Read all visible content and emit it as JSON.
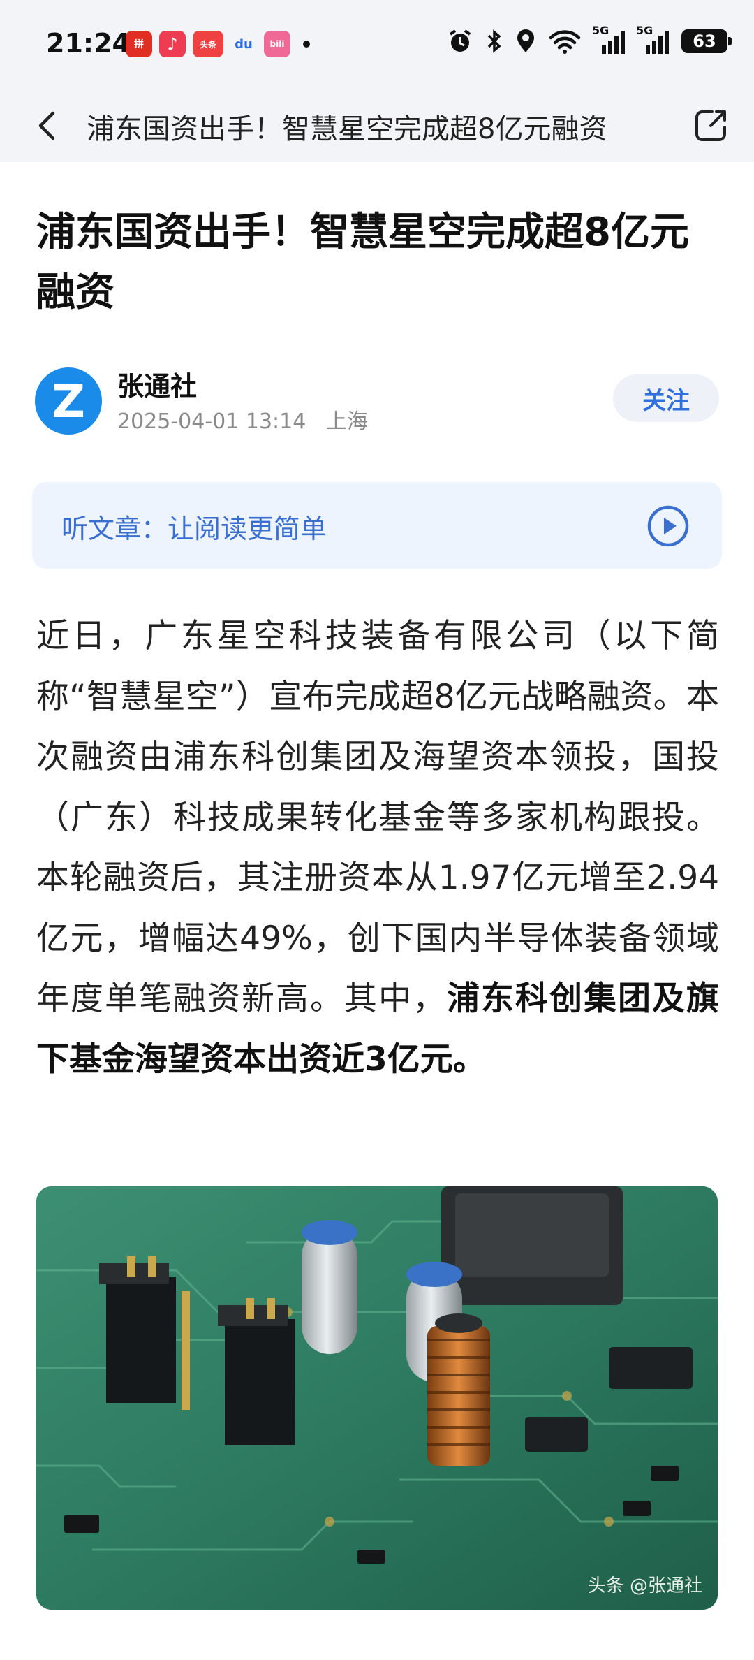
{
  "status_bar": {
    "time": "21:24",
    "apps": [
      {
        "name": "pinduoduo-icon",
        "color": "#e02e24",
        "glyph": "拼"
      },
      {
        "name": "music-icon",
        "color": "#ee3d52",
        "glyph": "♪"
      },
      {
        "name": "toutiao-icon",
        "color": "#f04142",
        "glyph": "头条"
      },
      {
        "name": "baidu-icon",
        "color": "#2f6fe0",
        "glyph": "du"
      },
      {
        "name": "bilibili-icon",
        "color": "#f06996",
        "glyph": "bili"
      }
    ],
    "network1": "5G",
    "network2": "5G",
    "battery": "63"
  },
  "nav": {
    "title": "浦东国资出手！智慧星空完成超8亿元融资"
  },
  "article": {
    "headline": "浦东国资出手！智慧星空完成超8亿元融资",
    "author": "张通社",
    "avatar_letter": "Z",
    "publish_time": "2025-04-01 13:14",
    "location": "上海",
    "follow_label": "关注",
    "listen_label": "听文章：让阅读更简单",
    "body_plain": "近日，广东星空科技装备有限公司（以下简称“智慧星空”）宣布完成超8亿元战略融资。本次融资由浦东科创集团及海望资本领投，国投（广东）科技成果转化基金等多家机构跟投。本轮融资后，其注册资本从1.97亿元增至2.94亿元，增幅达49%，创下国内半导体装备领域年度单笔融资新高。其中，",
    "body_bold": "浦东科创集团及旗下基金海望资本出资近3亿元。",
    "image_watermark": "头条 @张通社"
  },
  "colors": {
    "accent": "#2f6fe0",
    "avatar": "#1a8be8",
    "listen_bg": "#edf4fd"
  }
}
